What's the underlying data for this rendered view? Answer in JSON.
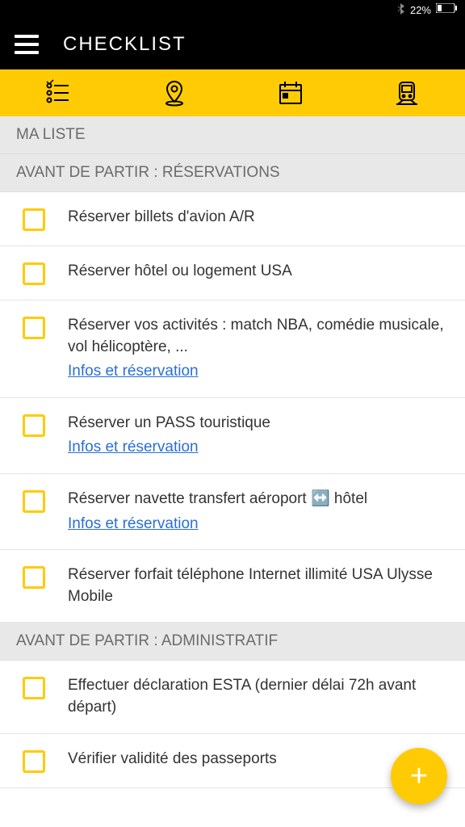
{
  "status": {
    "battery_percent": "22%"
  },
  "header": {
    "title": "CHECKLIST"
  },
  "sections": {
    "ma_liste": "MA LISTE",
    "reservations": "AVANT DE PARTIR : RÉSERVATIONS",
    "administratif": "AVANT DE PARTIR : ADMINISTRATIF"
  },
  "items": {
    "r0": {
      "text": "Réserver billets d'avion A/R"
    },
    "r1": {
      "text": "Réserver hôtel ou logement USA"
    },
    "r2": {
      "text": "Réserver vos activités : match NBA, comédie musicale, vol hélicoptère, ...",
      "link": "Infos et réservation"
    },
    "r3": {
      "text": "Réserver un PASS touristique",
      "link": "Infos et réservation"
    },
    "r4": {
      "text": "Réserver navette transfert aéroport ↔️ hôtel",
      "link": "Infos et réservation"
    },
    "r5": {
      "text": "Réserver forfait téléphone Internet illimité USA Ulysse Mobile"
    },
    "a0": {
      "text": "Effectuer déclaration ESTA (dernier délai 72h avant départ)"
    },
    "a1": {
      "text": "Vérifier validité des passeports"
    }
  }
}
